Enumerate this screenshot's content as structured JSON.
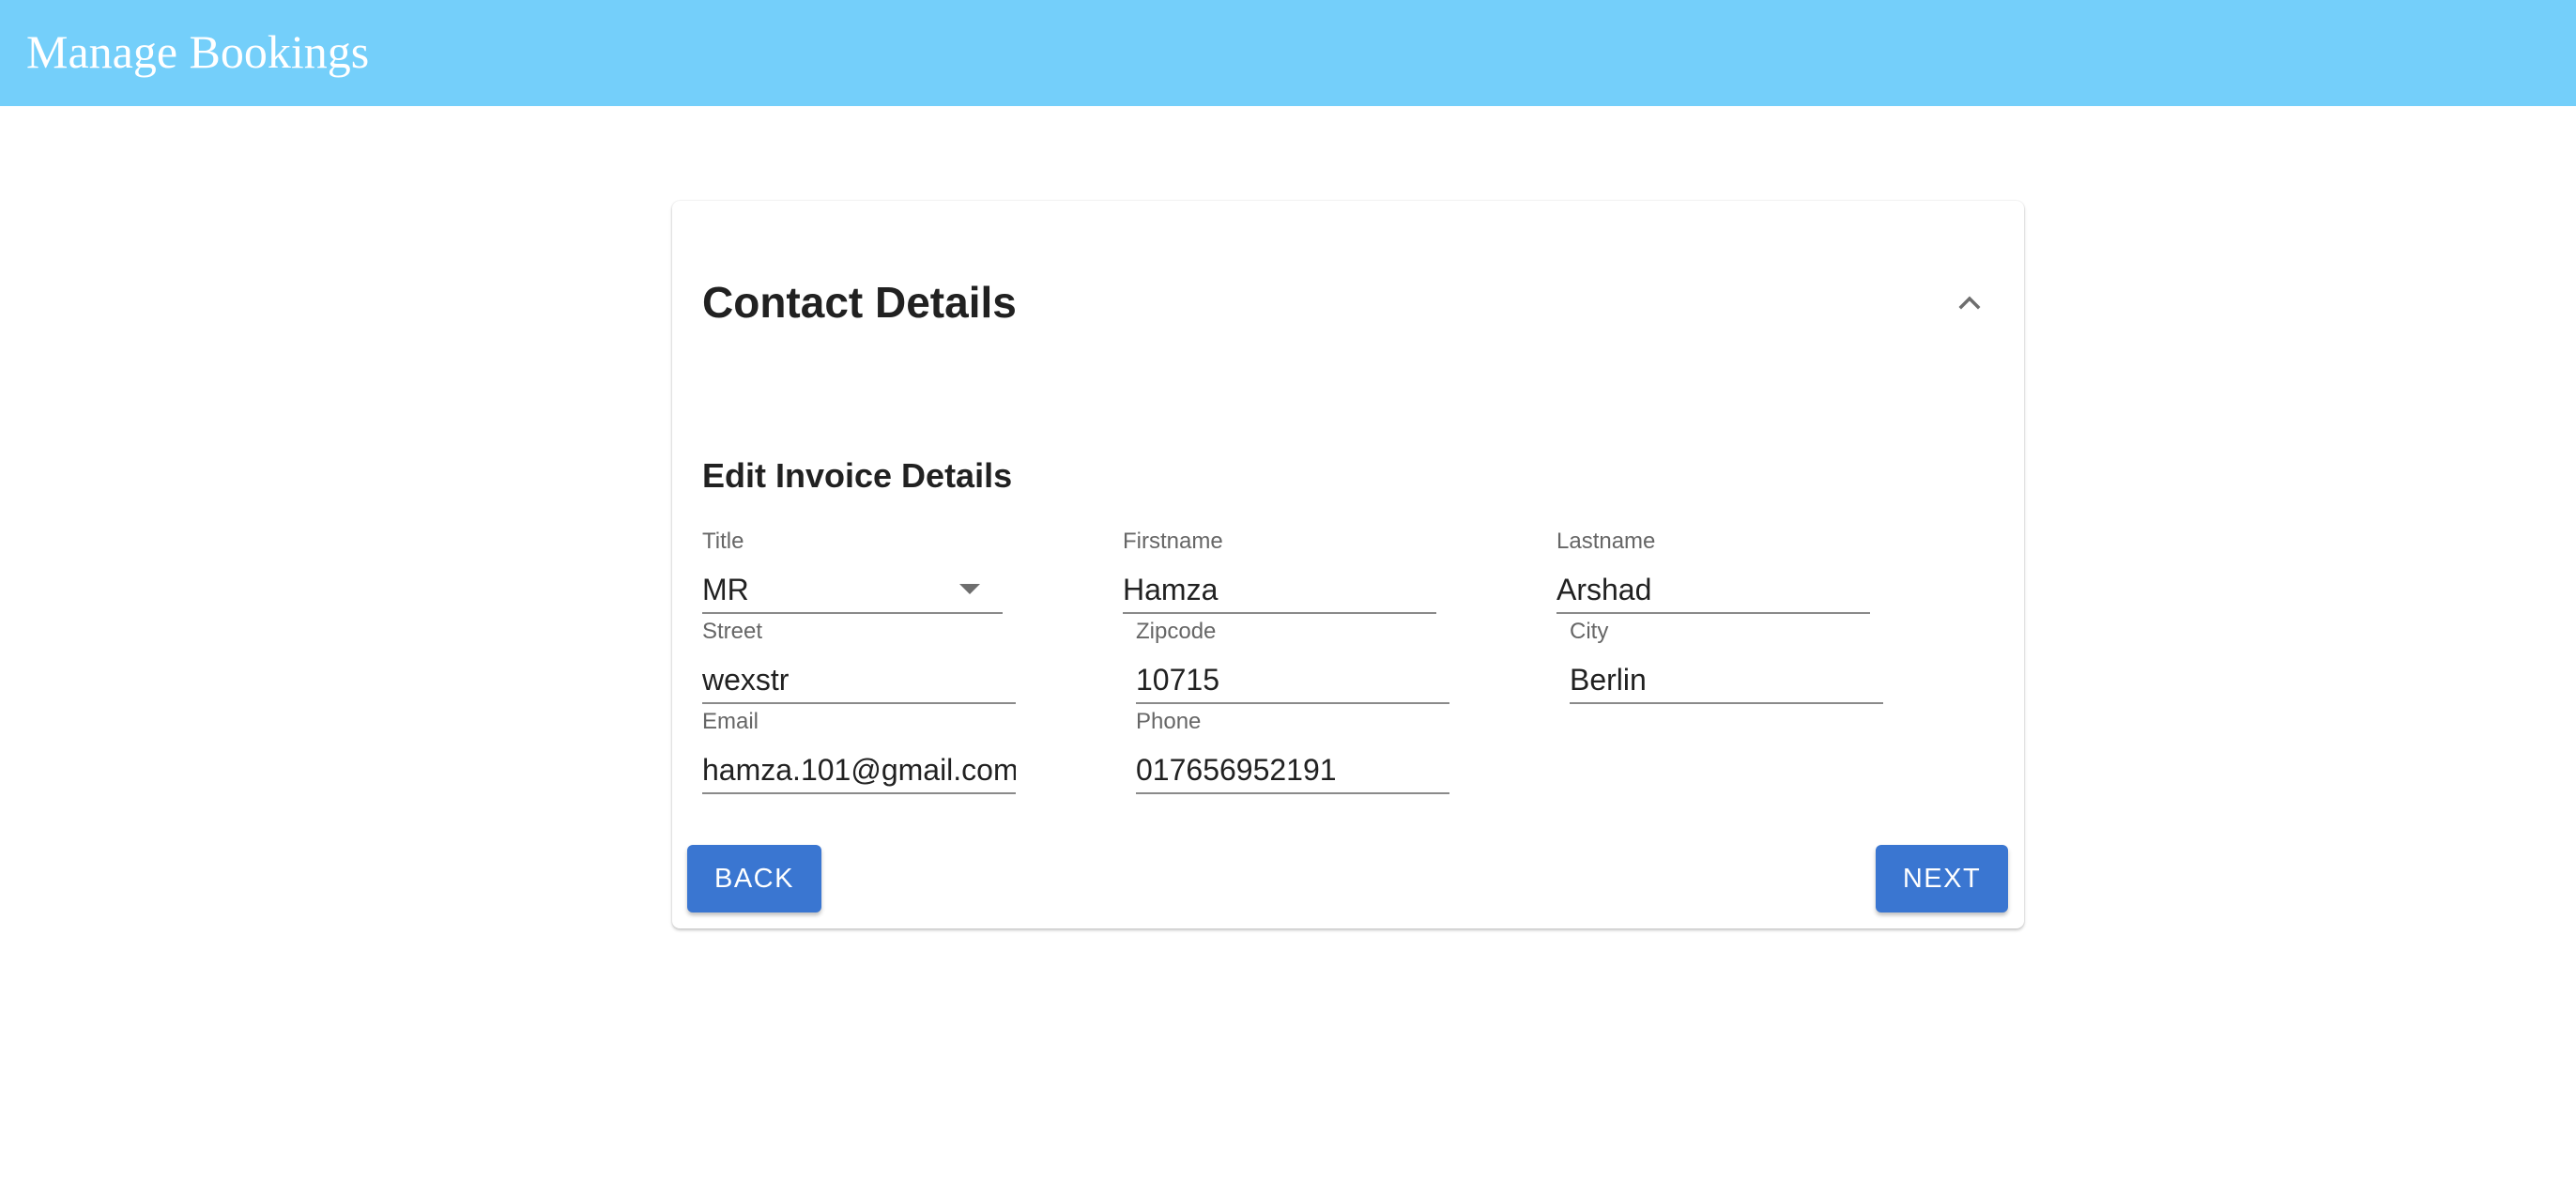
{
  "appbar": {
    "title": "Manage Bookings",
    "color": "#74cffa"
  },
  "card": {
    "title": "Contact Details",
    "toggle_icon": "chevron-up-icon",
    "section_title": "Edit Invoice Details",
    "fields": {
      "title": {
        "label": "Title",
        "value": "MR"
      },
      "firstname": {
        "label": "Firstname",
        "value": "Hamza"
      },
      "lastname": {
        "label": "Lastname",
        "value": "Arshad"
      },
      "street": {
        "label": "Street",
        "value": "wexstr"
      },
      "zipcode": {
        "label": "Zipcode",
        "value": "10715"
      },
      "city": {
        "label": "City",
        "value": "Berlin"
      },
      "email": {
        "label": "Email",
        "value": "hamza.101@gmail.com"
      },
      "phone": {
        "label": "Phone",
        "value": "017656952191"
      }
    },
    "buttons": {
      "back_label": "BACK",
      "next_label": "NEXT",
      "color": "#3a76d1"
    }
  }
}
